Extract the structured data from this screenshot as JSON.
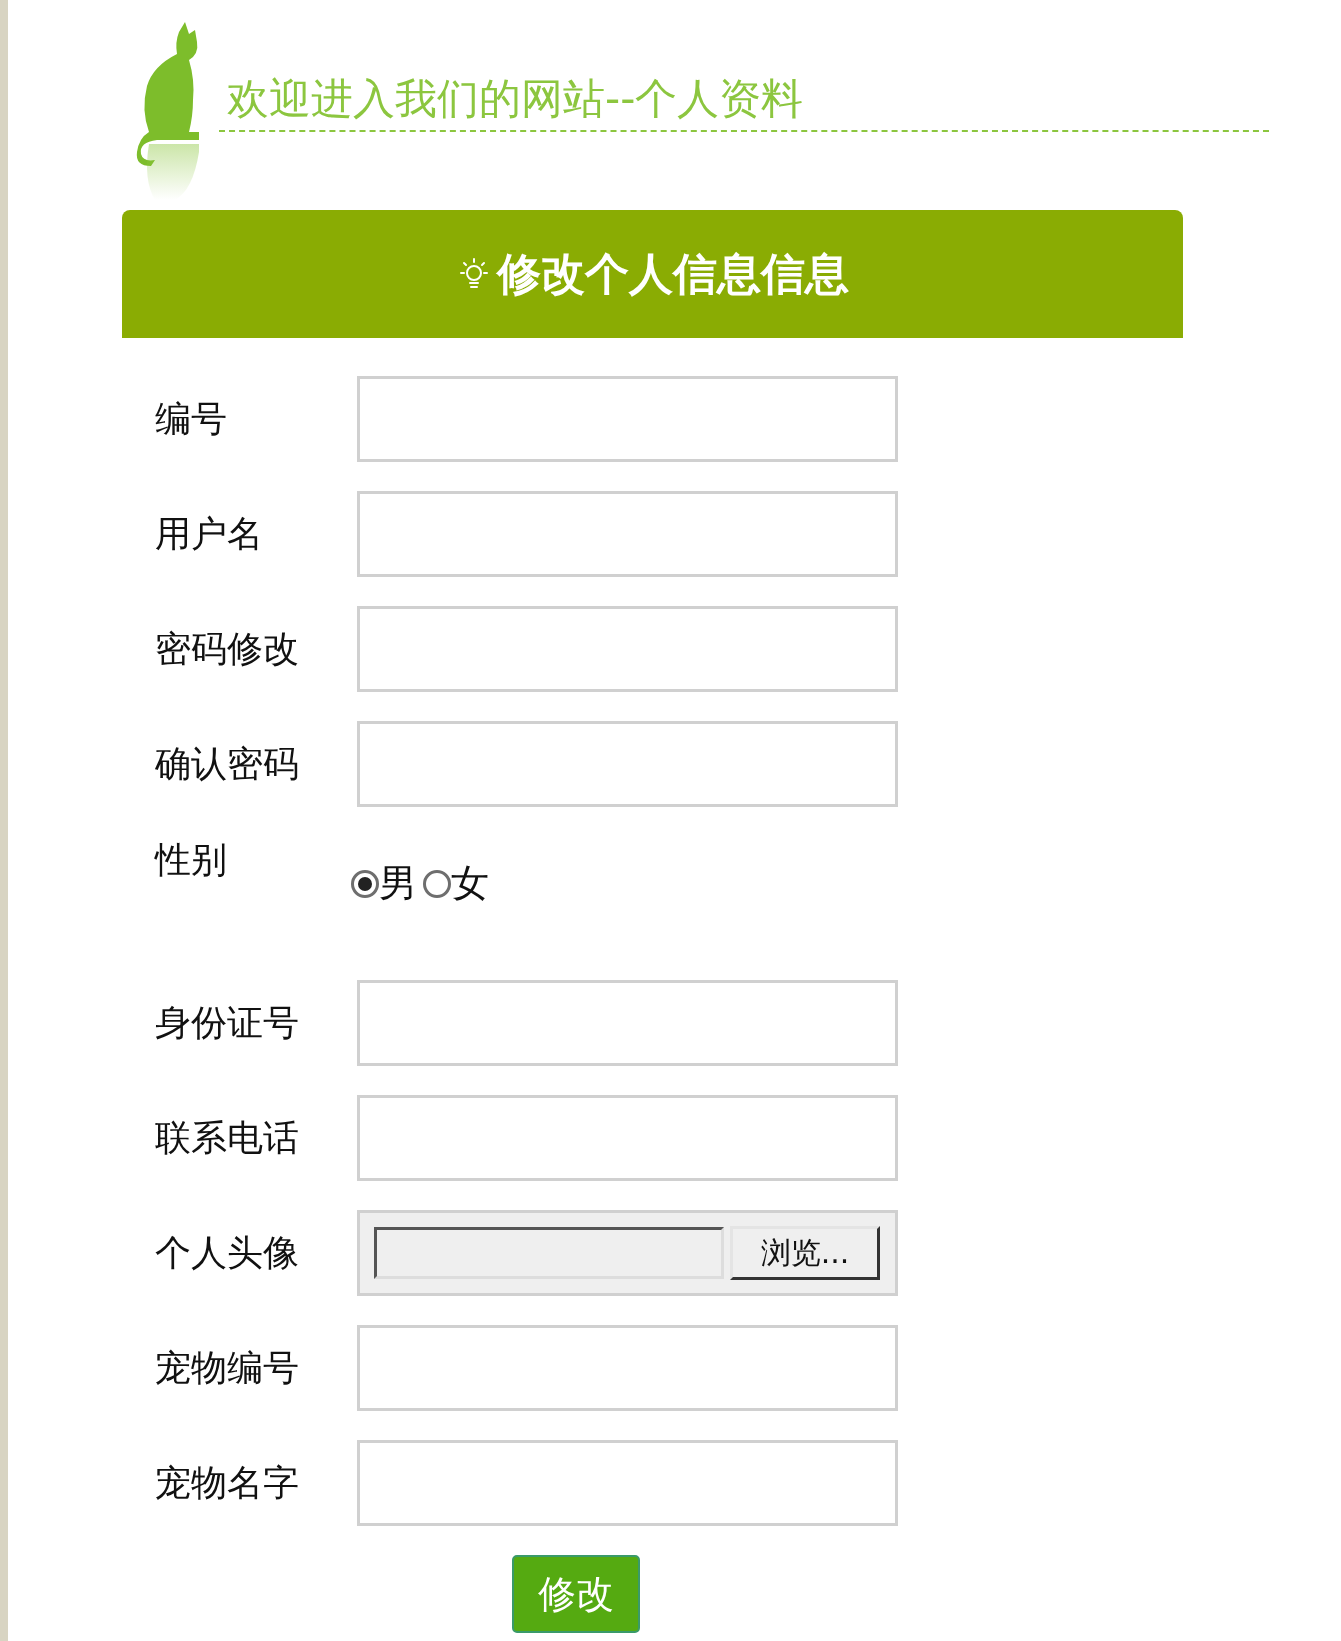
{
  "header": {
    "title": "欢迎进入我们的网站--个人资料"
  },
  "panel": {
    "title": "修改个人信息信息"
  },
  "fields": [
    {
      "label": "编号",
      "kind": "text"
    },
    {
      "label": "用户名",
      "kind": "text"
    },
    {
      "label": "密码修改",
      "kind": "text"
    },
    {
      "label": "确认密码",
      "kind": "text"
    },
    {
      "label": "性别",
      "kind": "radio",
      "options": [
        {
          "label": "男",
          "selected": true
        },
        {
          "label": "女",
          "selected": false
        }
      ]
    },
    {
      "label": "身份证号",
      "kind": "text"
    },
    {
      "label": "联系电话",
      "kind": "text"
    },
    {
      "label": "个人头像",
      "kind": "file",
      "button": "浏览..."
    },
    {
      "label": "宠物编号",
      "kind": "text"
    },
    {
      "label": "宠物名字",
      "kind": "text"
    }
  ],
  "submit": "修改"
}
